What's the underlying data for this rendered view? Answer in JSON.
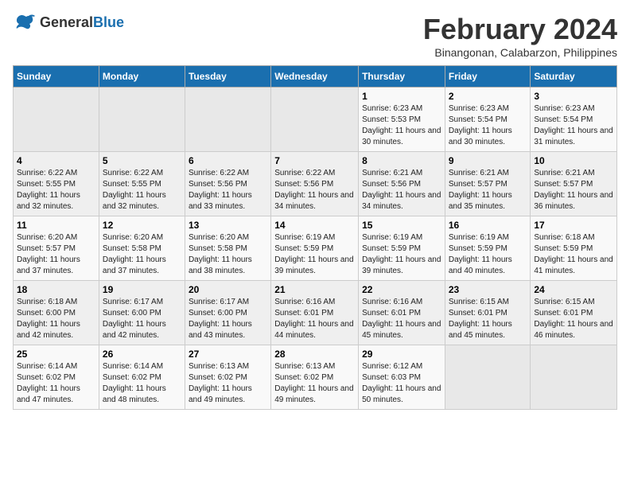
{
  "logo": {
    "general": "General",
    "blue": "Blue"
  },
  "title": {
    "month_year": "February 2024",
    "location": "Binangonan, Calabarzon, Philippines"
  },
  "days_of_week": [
    "Sunday",
    "Monday",
    "Tuesday",
    "Wednesday",
    "Thursday",
    "Friday",
    "Saturday"
  ],
  "weeks": [
    [
      {
        "day": "",
        "sunrise": "",
        "sunset": "",
        "daylight": "",
        "empty": true
      },
      {
        "day": "",
        "sunrise": "",
        "sunset": "",
        "daylight": "",
        "empty": true
      },
      {
        "day": "",
        "sunrise": "",
        "sunset": "",
        "daylight": "",
        "empty": true
      },
      {
        "day": "",
        "sunrise": "",
        "sunset": "",
        "daylight": "",
        "empty": true
      },
      {
        "day": "1",
        "sunrise": "Sunrise: 6:23 AM",
        "sunset": "Sunset: 5:53 PM",
        "daylight": "Daylight: 11 hours and 30 minutes."
      },
      {
        "day": "2",
        "sunrise": "Sunrise: 6:23 AM",
        "sunset": "Sunset: 5:54 PM",
        "daylight": "Daylight: 11 hours and 30 minutes."
      },
      {
        "day": "3",
        "sunrise": "Sunrise: 6:23 AM",
        "sunset": "Sunset: 5:54 PM",
        "daylight": "Daylight: 11 hours and 31 minutes."
      }
    ],
    [
      {
        "day": "4",
        "sunrise": "Sunrise: 6:22 AM",
        "sunset": "Sunset: 5:55 PM",
        "daylight": "Daylight: 11 hours and 32 minutes."
      },
      {
        "day": "5",
        "sunrise": "Sunrise: 6:22 AM",
        "sunset": "Sunset: 5:55 PM",
        "daylight": "Daylight: 11 hours and 32 minutes."
      },
      {
        "day": "6",
        "sunrise": "Sunrise: 6:22 AM",
        "sunset": "Sunset: 5:56 PM",
        "daylight": "Daylight: 11 hours and 33 minutes."
      },
      {
        "day": "7",
        "sunrise": "Sunrise: 6:22 AM",
        "sunset": "Sunset: 5:56 PM",
        "daylight": "Daylight: 11 hours and 34 minutes."
      },
      {
        "day": "8",
        "sunrise": "Sunrise: 6:21 AM",
        "sunset": "Sunset: 5:56 PM",
        "daylight": "Daylight: 11 hours and 34 minutes."
      },
      {
        "day": "9",
        "sunrise": "Sunrise: 6:21 AM",
        "sunset": "Sunset: 5:57 PM",
        "daylight": "Daylight: 11 hours and 35 minutes."
      },
      {
        "day": "10",
        "sunrise": "Sunrise: 6:21 AM",
        "sunset": "Sunset: 5:57 PM",
        "daylight": "Daylight: 11 hours and 36 minutes."
      }
    ],
    [
      {
        "day": "11",
        "sunrise": "Sunrise: 6:20 AM",
        "sunset": "Sunset: 5:57 PM",
        "daylight": "Daylight: 11 hours and 37 minutes."
      },
      {
        "day": "12",
        "sunrise": "Sunrise: 6:20 AM",
        "sunset": "Sunset: 5:58 PM",
        "daylight": "Daylight: 11 hours and 37 minutes."
      },
      {
        "day": "13",
        "sunrise": "Sunrise: 6:20 AM",
        "sunset": "Sunset: 5:58 PM",
        "daylight": "Daylight: 11 hours and 38 minutes."
      },
      {
        "day": "14",
        "sunrise": "Sunrise: 6:19 AM",
        "sunset": "Sunset: 5:59 PM",
        "daylight": "Daylight: 11 hours and 39 minutes."
      },
      {
        "day": "15",
        "sunrise": "Sunrise: 6:19 AM",
        "sunset": "Sunset: 5:59 PM",
        "daylight": "Daylight: 11 hours and 39 minutes."
      },
      {
        "day": "16",
        "sunrise": "Sunrise: 6:19 AM",
        "sunset": "Sunset: 5:59 PM",
        "daylight": "Daylight: 11 hours and 40 minutes."
      },
      {
        "day": "17",
        "sunrise": "Sunrise: 6:18 AM",
        "sunset": "Sunset: 5:59 PM",
        "daylight": "Daylight: 11 hours and 41 minutes."
      }
    ],
    [
      {
        "day": "18",
        "sunrise": "Sunrise: 6:18 AM",
        "sunset": "Sunset: 6:00 PM",
        "daylight": "Daylight: 11 hours and 42 minutes."
      },
      {
        "day": "19",
        "sunrise": "Sunrise: 6:17 AM",
        "sunset": "Sunset: 6:00 PM",
        "daylight": "Daylight: 11 hours and 42 minutes."
      },
      {
        "day": "20",
        "sunrise": "Sunrise: 6:17 AM",
        "sunset": "Sunset: 6:00 PM",
        "daylight": "Daylight: 11 hours and 43 minutes."
      },
      {
        "day": "21",
        "sunrise": "Sunrise: 6:16 AM",
        "sunset": "Sunset: 6:01 PM",
        "daylight": "Daylight: 11 hours and 44 minutes."
      },
      {
        "day": "22",
        "sunrise": "Sunrise: 6:16 AM",
        "sunset": "Sunset: 6:01 PM",
        "daylight": "Daylight: 11 hours and 45 minutes."
      },
      {
        "day": "23",
        "sunrise": "Sunrise: 6:15 AM",
        "sunset": "Sunset: 6:01 PM",
        "daylight": "Daylight: 11 hours and 45 minutes."
      },
      {
        "day": "24",
        "sunrise": "Sunrise: 6:15 AM",
        "sunset": "Sunset: 6:01 PM",
        "daylight": "Daylight: 11 hours and 46 minutes."
      }
    ],
    [
      {
        "day": "25",
        "sunrise": "Sunrise: 6:14 AM",
        "sunset": "Sunset: 6:02 PM",
        "daylight": "Daylight: 11 hours and 47 minutes."
      },
      {
        "day": "26",
        "sunrise": "Sunrise: 6:14 AM",
        "sunset": "Sunset: 6:02 PM",
        "daylight": "Daylight: 11 hours and 48 minutes."
      },
      {
        "day": "27",
        "sunrise": "Sunrise: 6:13 AM",
        "sunset": "Sunset: 6:02 PM",
        "daylight": "Daylight: 11 hours and 49 minutes."
      },
      {
        "day": "28",
        "sunrise": "Sunrise: 6:13 AM",
        "sunset": "Sunset: 6:02 PM",
        "daylight": "Daylight: 11 hours and 49 minutes."
      },
      {
        "day": "29",
        "sunrise": "Sunrise: 6:12 AM",
        "sunset": "Sunset: 6:03 PM",
        "daylight": "Daylight: 11 hours and 50 minutes."
      },
      {
        "day": "",
        "sunrise": "",
        "sunset": "",
        "daylight": "",
        "empty": true
      },
      {
        "day": "",
        "sunrise": "",
        "sunset": "",
        "daylight": "",
        "empty": true
      }
    ]
  ]
}
